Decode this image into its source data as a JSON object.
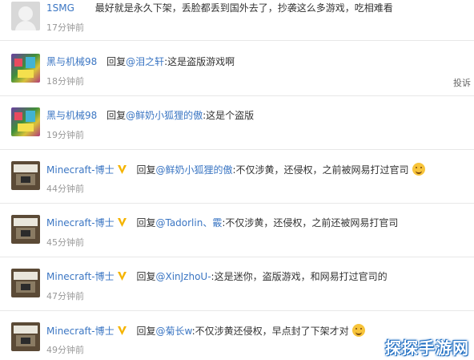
{
  "comments": [
    {
      "username": "1SMG",
      "reply_prefix": "",
      "mention": "",
      "text": "最好就是永久下架，丢脸都丢到国外去了，抄袭这么多游戏，吃相难看",
      "time": "17分钟前"
    },
    {
      "username": "黑与机械98",
      "reply_prefix": "回复",
      "mention": "@泪之轩",
      "text": ":这是盗版游戏啊",
      "time": "18分钟前",
      "report": "投诉"
    },
    {
      "username": "黑与机械98",
      "reply_prefix": "回复",
      "mention": "@鲜奶小狐狸的傲",
      "text": ":这是个盗版",
      "time": "19分钟前"
    },
    {
      "username": "Minecraft-博士",
      "reply_prefix": "回复",
      "mention": "@鲜奶小狐狸的傲",
      "text": ":不仅涉黄，还侵权，之前被网易打过官司",
      "time": "44分钟前"
    },
    {
      "username": "Minecraft-博士",
      "reply_prefix": "回复",
      "mention": "@Tadorlin、霰",
      "text": ":不仅涉黄，还侵权，之前还被网易打官司",
      "time": "45分钟前"
    },
    {
      "username": "Minecraft-博士",
      "reply_prefix": "回复",
      "mention": "@XinJzhoU-",
      "text": ":这是迷你，盗版游戏，和网易打过官司的",
      "time": "47分钟前"
    },
    {
      "username": "Minecraft-博士",
      "reply_prefix": "回复",
      "mention": "@菊长w",
      "text": ":不仅涉黄还侵权，早点封了下架才对",
      "time": "49分钟前"
    }
  ],
  "watermark": "探探手游网",
  "colors": {
    "link": "#3b76c3",
    "time": "#999999",
    "badge": "#f5b400"
  }
}
